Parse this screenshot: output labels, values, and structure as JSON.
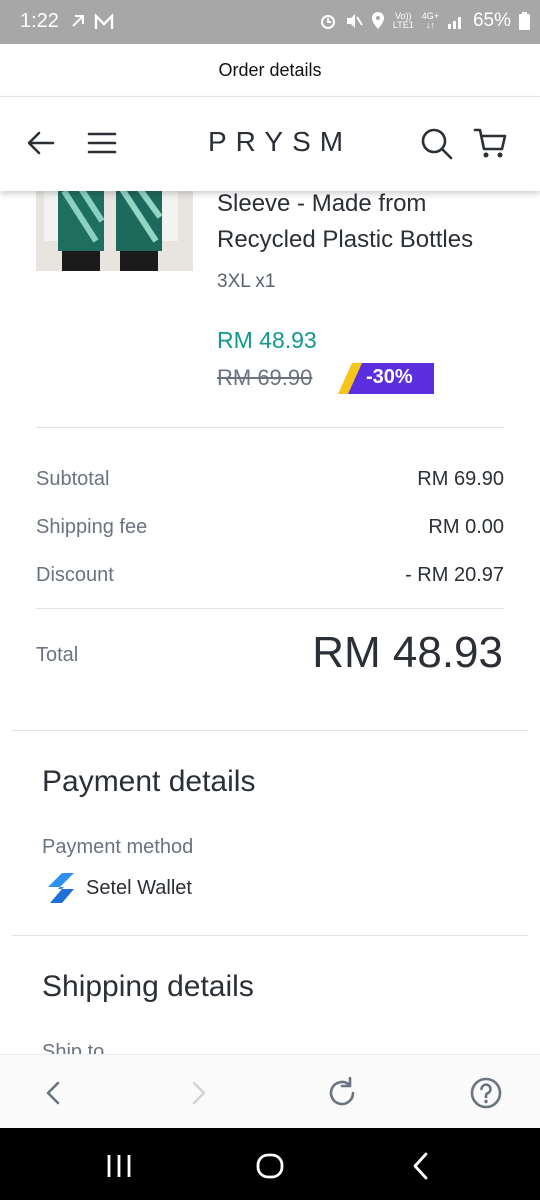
{
  "status_bar": {
    "time": "1:22",
    "network": "Vo))",
    "network_sub": "LTE1",
    "data_type": "4G+",
    "battery": "65%"
  },
  "webview": {
    "title": "Order details"
  },
  "header": {
    "brand": "PRYSM"
  },
  "product": {
    "title_line1": "Sleeve - Made from",
    "title_line2": "Recycled Plastic Bottles",
    "variant": "3XL x1",
    "price": "RM 48.93",
    "original_price": "RM 69.90",
    "discount_badge": "-30%"
  },
  "summary": {
    "subtotal_label": "Subtotal",
    "subtotal_value": "RM 69.90",
    "shipping_label": "Shipping fee",
    "shipping_value": "RM 0.00",
    "discount_label": "Discount",
    "discount_value": "- RM 20.97",
    "total_label": "Total",
    "total_value": "RM 48.93"
  },
  "payment": {
    "section_title": "Payment details",
    "method_label": "Payment method",
    "method_value": "Setel Wallet"
  },
  "shipping": {
    "section_title": "Shipping details",
    "ship_to_label": "Ship to"
  },
  "colors": {
    "accent_teal": "#11998e",
    "badge_purple": "#5b2ee0",
    "badge_yellow": "#f5c518",
    "text_dark": "#2b2f36",
    "text_muted": "#6b7280"
  },
  "icons": [
    "back-arrow-icon",
    "menu-icon",
    "search-icon",
    "cart-icon",
    "browser-back-icon",
    "browser-forward-icon",
    "refresh-icon",
    "help-icon",
    "recent-apps-icon",
    "home-icon",
    "nav-back-icon",
    "setel-icon"
  ]
}
